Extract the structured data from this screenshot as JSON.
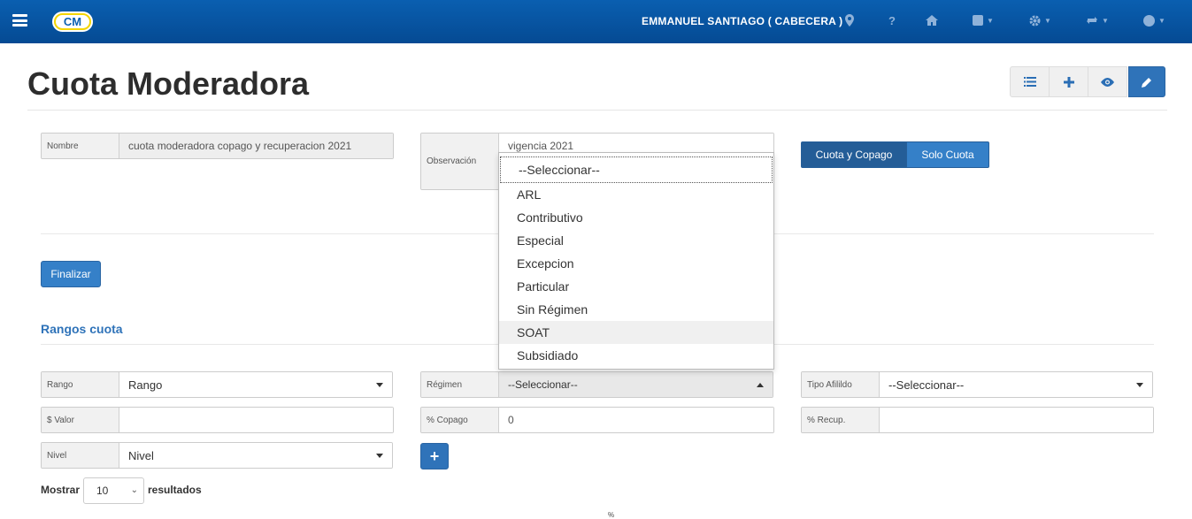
{
  "header": {
    "user": "EMMANUEL SANTIAGO ( CABECERA )",
    "logo_text": "CM",
    "icons": [
      "map-marker-icon",
      "help-icon",
      "home-icon",
      "module-icon",
      "settings-icon",
      "refresh-icon",
      "user-circle-icon"
    ],
    "help_glyph": "?"
  },
  "page": {
    "title": "Cuota Moderadora",
    "toolbar": [
      "list-icon",
      "plus-icon",
      "eye-icon",
      "pencil-icon"
    ]
  },
  "form": {
    "nombre_label": "Nombre",
    "nombre_value": "cuota moderadora copago y recuperacion 2021",
    "observacion_label": "Observación",
    "observacion_value": "vigencia 2021",
    "toggle_option_1": "Cuota y Copago",
    "toggle_option_2": "Solo Cuota",
    "finalizar_label": "Finalizar"
  },
  "rangos": {
    "section_title": "Rangos cuota",
    "rango_label": "Rango",
    "rango_value": "Rango",
    "regimen_label": "Régimen",
    "regimen_value": "--Seleccionar--",
    "tipo_afiliado_label": "Tipo Afilildo",
    "tipo_afiliado_value": "--Seleccionar--",
    "valor_label": "$ Valor",
    "valor_value": "",
    "copago_label": "% Copago",
    "copago_value": "0",
    "recup_label": "% Recup.",
    "recup_value": "",
    "nivel_label": "Nivel",
    "nivel_value": "Nivel",
    "add_label": "+"
  },
  "regimen_dropdown": {
    "options": [
      "--Seleccionar--",
      "ARL",
      "Contributivo",
      "Especial",
      "Excepcion",
      "Particular",
      "Sin Régimen",
      "SOAT",
      "Subsidiado"
    ],
    "highlighted": "SOAT"
  },
  "table": {
    "mostrar_label": "Mostrar",
    "page_size": "10",
    "resultados_label": "resultados",
    "partial_header": "%"
  },
  "colors": {
    "primary": "#2f73b9",
    "header_bg": "#054a93"
  }
}
